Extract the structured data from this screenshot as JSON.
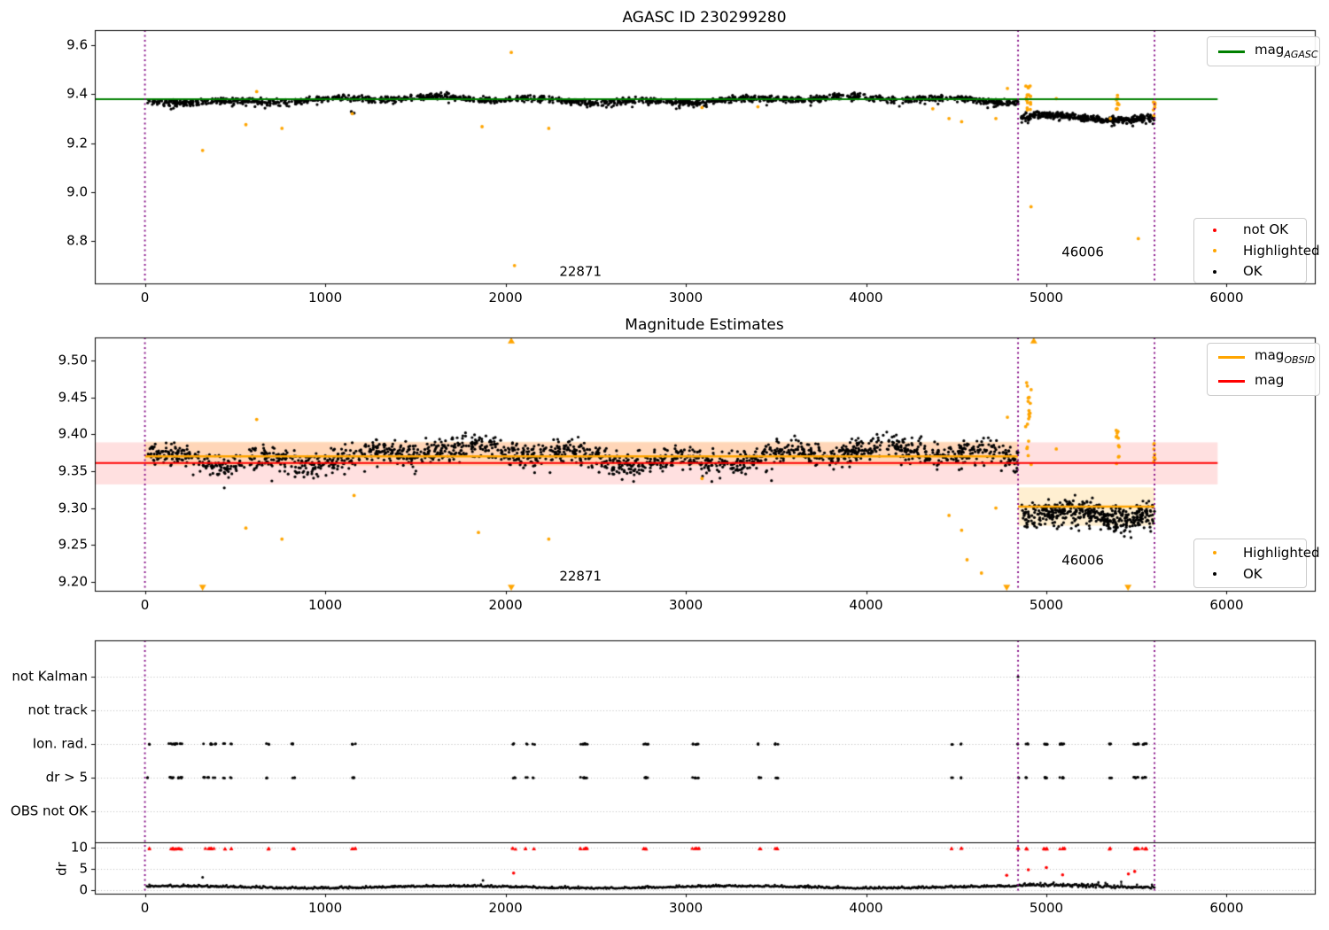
{
  "figure": {
    "background": "#ffffff"
  },
  "colors": {
    "ok": "#000000",
    "not_ok": "#ff0000",
    "highlighted": "#ffa500",
    "mag_agasc_line": "#008000",
    "mag_line": "#ff0000",
    "mag_obsid_line": "#ffa500",
    "obsid_vline": "#800080",
    "mag_band_fill": "rgba(255,0,0,0.12)",
    "obsid_band_fill": "rgba(255,165,0,0.18)",
    "grid": "#bbbbbb"
  },
  "chart_data": [
    {
      "type": "scatter",
      "title": "AGASC ID 230299280",
      "xlim": [
        -278,
        6489
      ],
      "ylim": [
        8.627,
        9.661
      ],
      "xticks": [
        "0",
        "1000",
        "2000",
        "3000",
        "4000",
        "5000",
        "6000"
      ],
      "yticks": [
        "8.8",
        "9.0",
        "9.2",
        "9.4",
        "9.6"
      ],
      "hlines": [
        {
          "name": "mag_agasc",
          "y": 9.379,
          "x0": -278,
          "x1": 5950,
          "color_key": "mag_agasc_line"
        }
      ],
      "vlines": [
        0,
        4843,
        5600
      ],
      "ok_segments": [
        {
          "x0": 15,
          "x1": 4843,
          "mean": 9.377,
          "sigma": 0.012,
          "n": 1600
        },
        {
          "x0": 4860,
          "x1": 5600,
          "mean": 9.303,
          "sigma": 0.014,
          "n": 430
        }
      ],
      "ok_extra_points": [
        [
          1145,
          9.328
        ],
        [
          1160,
          9.322
        ]
      ],
      "highlighted_points": [
        [
          320,
          9.17
        ],
        [
          560,
          9.275
        ],
        [
          620,
          9.41
        ],
        [
          760,
          9.26
        ],
        [
          1150,
          9.32
        ],
        [
          1870,
          9.267
        ],
        [
          2032,
          9.57
        ],
        [
          2050,
          8.7
        ],
        [
          2240,
          9.26
        ],
        [
          3090,
          9.345
        ],
        [
          3400,
          9.348
        ],
        [
          4370,
          9.34
        ],
        [
          4460,
          9.3
        ],
        [
          4530,
          9.287
        ],
        [
          4720,
          9.3
        ],
        [
          4784,
          9.423
        ],
        [
          4915,
          8.94
        ],
        [
          5055,
          9.381
        ],
        [
          5355,
          9.3
        ],
        [
          5510,
          8.81
        ]
      ],
      "highlighted_clusters": [
        {
          "x": 4900,
          "hw": 18,
          "n": 16,
          "y0": 9.33,
          "y1": 9.435
        },
        {
          "x": 5395,
          "hw": 9,
          "n": 10,
          "y0": 9.335,
          "y1": 9.405
        },
        {
          "x": 5598,
          "hw": 5,
          "n": 7,
          "y0": 9.31,
          "y1": 9.385
        }
      ],
      "annotations": [
        {
          "text": "22871",
          "x": 2416,
          "y": 8.674
        },
        {
          "text": "46006",
          "x": 5202,
          "y": 8.754
        }
      ],
      "legend_line": {
        "items": [
          {
            "text": "mag",
            "sub": "AGASC",
            "color_key": "mag_agasc_line"
          }
        ]
      },
      "legend_markers": {
        "items": [
          {
            "label": "not OK",
            "color_key": "not_ok"
          },
          {
            "label": "Highlighted",
            "color_key": "highlighted"
          },
          {
            "label": "OK",
            "color_key": "ok"
          }
        ]
      }
    },
    {
      "type": "scatter",
      "title": "Magnitude Estimates",
      "xlim": [
        -278,
        6489
      ],
      "ylim": [
        9.188,
        9.531
      ],
      "xticks": [
        "0",
        "1000",
        "2000",
        "3000",
        "4000",
        "5000",
        "6000"
      ],
      "yticks": [
        "9.20",
        "9.25",
        "9.30",
        "9.35",
        "9.40",
        "9.45",
        "9.50"
      ],
      "mag_line": {
        "y": 9.361,
        "x0": -278,
        "x1": 5950,
        "band": [
          9.332,
          9.389
        ]
      },
      "obsid_lines": [
        {
          "obsid": "22871",
          "x0": 0,
          "x1": 4843,
          "y": 9.37,
          "band": [
            9.357,
            9.39
          ]
        },
        {
          "obsid": "46006",
          "x0": 4843,
          "x1": 5600,
          "y": 9.302,
          "band": [
            9.276,
            9.328
          ]
        }
      ],
      "vlines": [
        0,
        4843,
        5600
      ],
      "ok_segments": [
        {
          "x0": 15,
          "x1": 4843,
          "mean": 9.371,
          "sigma": 0.016,
          "n": 1700
        },
        {
          "x0": 4860,
          "x1": 5600,
          "mean": 9.299,
          "sigma": 0.016,
          "n": 450
        }
      ],
      "ok_extra_points": [],
      "highlighted_points": [
        [
          560,
          9.273
        ],
        [
          620,
          9.42
        ],
        [
          760,
          9.258
        ],
        [
          1160,
          9.317
        ],
        [
          1850,
          9.267
        ],
        [
          2240,
          9.258
        ],
        [
          3090,
          9.34
        ],
        [
          4460,
          9.29
        ],
        [
          4530,
          9.27
        ],
        [
          4560,
          9.23
        ],
        [
          4640,
          9.212
        ],
        [
          4720,
          9.3
        ],
        [
          4784,
          9.423
        ],
        [
          5055,
          9.38
        ]
      ],
      "highlighted_clusters": [
        {
          "x": 4900,
          "hw": 16,
          "n": 20,
          "y0": 9.35,
          "y1": 9.47
        },
        {
          "x": 5395,
          "hw": 9,
          "n": 12,
          "y0": 9.355,
          "y1": 9.41
        },
        {
          "x": 5598,
          "hw": 5,
          "n": 8,
          "y0": 9.355,
          "y1": 9.395
        }
      ],
      "clip_triangles_up_x": [
        2032,
        4930
      ],
      "clip_triangles_down_x": [
        320,
        2032,
        4780,
        5453
      ],
      "annotations": [
        {
          "text": "22871",
          "x": 2416,
          "y": 9.207
        },
        {
          "text": "46006",
          "x": 5202,
          "y": 9.229
        }
      ],
      "legend_line": {
        "items": [
          {
            "text": "mag",
            "sub": "OBSID",
            "color_key": "mag_obsid_line"
          },
          {
            "text": "mag",
            "sub": "",
            "color_key": "mag_line"
          }
        ]
      },
      "legend_markers": {
        "items": [
          {
            "label": "Highlighted",
            "color_key": "highlighted"
          },
          {
            "label": "OK",
            "color_key": "ok"
          }
        ]
      }
    },
    {
      "type": "flags",
      "categories": [
        "not Kalman",
        "not track",
        "Ion. rad.",
        "dr > 5",
        "OBS not OK"
      ],
      "dr_ticks": [
        "10",
        "5",
        "0"
      ],
      "ylabel": "dr",
      "xticks": [
        "0",
        "1000",
        "2000",
        "3000",
        "4000",
        "5000",
        "6000"
      ],
      "xlim": [
        -278,
        6489
      ],
      "vlines": [
        0,
        4843,
        5600
      ],
      "flag_rows_with_points": [
        "Ion. rad.",
        "dr > 5"
      ],
      "flag_clusters": [
        [
          20,
          6,
          2
        ],
        [
          170,
          38,
          12
        ],
        [
          360,
          35,
          9
        ],
        [
          440,
          6,
          2
        ],
        [
          478,
          6,
          2
        ],
        [
          680,
          9,
          3
        ],
        [
          822,
          9,
          3
        ],
        [
          1157,
          11,
          4
        ],
        [
          2047,
          9,
          3
        ],
        [
          2116,
          7,
          2
        ],
        [
          2155,
          7,
          2
        ],
        [
          2435,
          24,
          8
        ],
        [
          2778,
          13,
          5
        ],
        [
          3057,
          22,
          6
        ],
        [
          3408,
          9,
          3
        ],
        [
          3502,
          11,
          4
        ],
        [
          4480,
          7,
          2
        ],
        [
          4524,
          7,
          2
        ],
        [
          4843,
          5,
          2
        ],
        [
          4890,
          9,
          3
        ],
        [
          4995,
          12,
          6
        ],
        [
          5088,
          14,
          6
        ],
        [
          5355,
          7,
          3
        ],
        [
          5498,
          14,
          6
        ],
        [
          5545,
          14,
          6
        ]
      ],
      "not_ok_clip_dr": 9.75,
      "not_kalman_points_x": [
        4843
      ],
      "dr_red_points": [
        [
          2045,
          4.0
        ],
        [
          4780,
          3.5
        ],
        [
          4900,
          4.8
        ],
        [
          5000,
          5.3
        ],
        [
          5090,
          3.6
        ],
        [
          5455,
          3.8
        ],
        [
          5490,
          4.4
        ]
      ],
      "dr_black_points": [
        [
          320,
          3.0
        ],
        [
          1875,
          2.3
        ]
      ],
      "dr_trace": {
        "x0": 10,
        "x1": 5600,
        "n": 1150,
        "base": 0.55,
        "noise": 0.45,
        "hi_x0": 4843,
        "hi_extra": 0.55
      },
      "dr_limit_line": 10.6
    }
  ]
}
